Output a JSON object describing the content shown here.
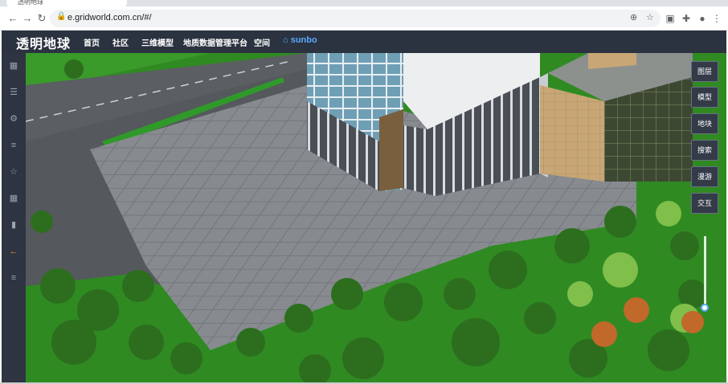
{
  "browser": {
    "tab_title": "透明地球",
    "url": "e.gridworld.com.cn/#/"
  },
  "header": {
    "title": "透明地球",
    "menu": [
      {
        "label": "首页"
      },
      {
        "label": "社区"
      },
      {
        "label": "三维模型"
      },
      {
        "label": "地质数据管理平台"
      },
      {
        "label": "空间"
      },
      {
        "label": "sunbo"
      }
    ]
  },
  "sidebar": {
    "icons": [
      "grid-icon",
      "sliders-icon",
      "settings-icon",
      "filter-icon",
      "star-icon",
      "apps-icon",
      "clipboard-icon",
      "arrow-left-icon",
      "menu-icon"
    ]
  },
  "right_panel": {
    "buttons": [
      {
        "label": "图层"
      },
      {
        "label": "模型"
      },
      {
        "label": "地块"
      },
      {
        "label": "搜索"
      },
      {
        "label": "漫游"
      },
      {
        "label": "交互"
      }
    ]
  },
  "colors": {
    "header_bg": "#2b3240",
    "sidebar_bg": "#2e3441",
    "accent": "#5aa9ff",
    "active_icon": "#f0a020",
    "grass": "#2f8a22",
    "pavement": "#8a8e92"
  }
}
